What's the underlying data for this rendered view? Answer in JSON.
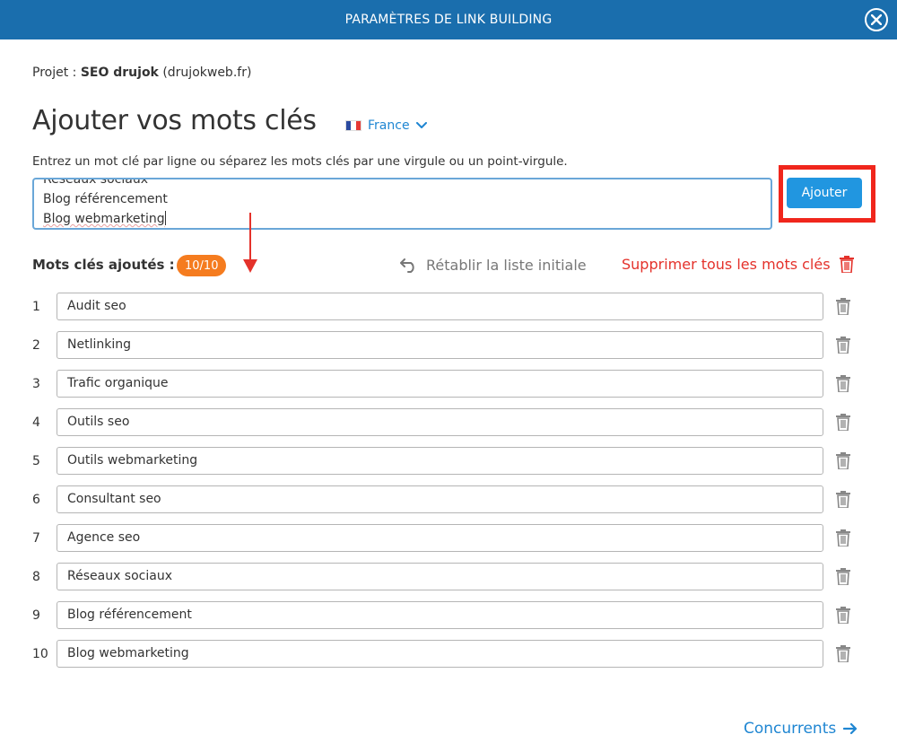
{
  "header": {
    "title": "PARAMÈTRES DE LINK BUILDING"
  },
  "project": {
    "label": "Projet :",
    "name": "SEO drujok",
    "domain": "(drujokweb.fr)"
  },
  "main": {
    "title": "Ajouter vos mots clés",
    "country": "France",
    "instructions": "Entrez un mot clé par ligne ou séparez les mots clés par une virgule ou un point-virgule.",
    "textarea_lines": [
      "Réseaux sociaux",
      "Blog référencement",
      "Blog webmarketing"
    ],
    "add_button": "Ajouter"
  },
  "keywords_section": {
    "label": "Mots clés ajoutés :",
    "count": "10/10",
    "reset_label": "Rétablir la liste initiale",
    "delete_all_label": "Supprimer tous les mots clés"
  },
  "keywords": [
    {
      "num": "1",
      "value": "Audit seo"
    },
    {
      "num": "2",
      "value": "Netlinking"
    },
    {
      "num": "3",
      "value": "Trafic organique"
    },
    {
      "num": "4",
      "value": "Outils seo"
    },
    {
      "num": "5",
      "value": "Outils webmarketing"
    },
    {
      "num": "6",
      "value": "Consultant seo"
    },
    {
      "num": "7",
      "value": "Agence seo"
    },
    {
      "num": "8",
      "value": "Réseaux sociaux"
    },
    {
      "num": "9",
      "value": "Blog référencement"
    },
    {
      "num": "10",
      "value": "Blog webmarketing"
    }
  ],
  "footer": {
    "next_label": "Concurrents"
  },
  "colors": {
    "header_bg": "#1a6ead",
    "accent": "#2196e0",
    "link": "#1f86d2",
    "danger": "#e4322b",
    "badge": "#f57c1f",
    "highlight": "#f0261c"
  },
  "icons": {
    "close": "close-icon",
    "flag": "france-flag-icon",
    "chevron": "chevron-down-icon",
    "reset": "undo-icon",
    "trash": "trash-icon",
    "arrow": "arrow-right-icon"
  }
}
